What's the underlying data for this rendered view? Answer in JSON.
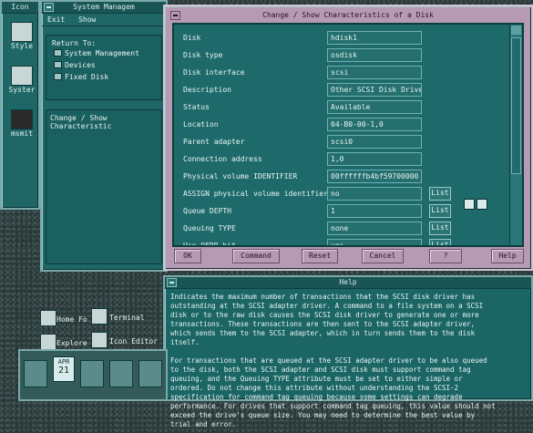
{
  "iconbox": {
    "title": "Icon",
    "items": [
      {
        "label": "Style",
        "icon": "style-icon"
      },
      {
        "label": "Syster",
        "icon": "system-icon"
      },
      {
        "label": "msmit",
        "icon": "user-icon"
      }
    ]
  },
  "sysmgmt": {
    "title": "System Managem",
    "menu": [
      "Exit",
      "Show"
    ],
    "return_to_label": "Return To:",
    "return_items": [
      "System Management",
      "Devices",
      "Fixed Disk"
    ],
    "current": "Change / Show Characteristic"
  },
  "dialog": {
    "title": "Change / Show Characteristics of a Disk",
    "fields": [
      {
        "label": "Disk",
        "value": "hdisk1",
        "list": ""
      },
      {
        "label": "Disk type",
        "value": "osdisk",
        "list": ""
      },
      {
        "label": "Disk interface",
        "value": "scsi",
        "list": ""
      },
      {
        "label": "Description",
        "value": "Other SCSI Disk Drive",
        "list": ""
      },
      {
        "label": "Status",
        "value": "Available",
        "list": ""
      },
      {
        "label": "Location",
        "value": "04-B0-00-1,0",
        "list": ""
      },
      {
        "label": "Parent adapter",
        "value": "scsi0",
        "list": ""
      },
      {
        "label": "Connection address",
        "value": "1,0",
        "list": ""
      },
      {
        "label": "Physical volume IDENTIFIER",
        "value": "00ffffffb4bf59700000",
        "list": ""
      },
      {
        "label": "ASSIGN physical volume identifier",
        "value": "no",
        "list": "List"
      },
      {
        "label": "Queue DEPTH",
        "value": "1",
        "list": "List"
      },
      {
        "label": "Queuing TYPE",
        "value": "none",
        "list": "List"
      },
      {
        "label": "Use QERR bit",
        "value": "yes",
        "list": "List"
      }
    ],
    "buttons": [
      "OK",
      "Command",
      "Reset",
      "Cancel",
      "?",
      "Help"
    ]
  },
  "help": {
    "title": "Help",
    "text": "Indicates the maximum number of transactions that the SCSI disk driver has\noutstanding at the SCSI adapter driver. A command to a file system on a SCSI\ndisk or to the raw disk causes the SCSI disk driver to generate one or more\ntransactions. These transactions are then sent to the SCSI adapter driver,\nwhich sends them to the SCSI adapter, which in turn sends them to the disk\nitself.\n\nFor transactions that are queued at the SCSI adapter driver to be also queued\nto the disk, both the SCSI adapter and SCSI disk must support command tag\nqueuing, and the Queuing TYPE attribute must be set to either simple or\nordered. Do not change this attribute without understanding the SCSI-2\nspecification for command tag queuing because some settings can degrade\nperformance. For drives that support command tag queuing, this value should not\nexceed the drive's queue size. You may need to determine the best value by\ntrial and error."
  },
  "desktop": {
    "home_label": "Home Fo",
    "terminal_label": "Terminal",
    "explorer_label": "Explore",
    "icon_editor_label": "Icon Editor"
  },
  "taskbar": {
    "cal_month": "APR",
    "cal_day": "21"
  }
}
